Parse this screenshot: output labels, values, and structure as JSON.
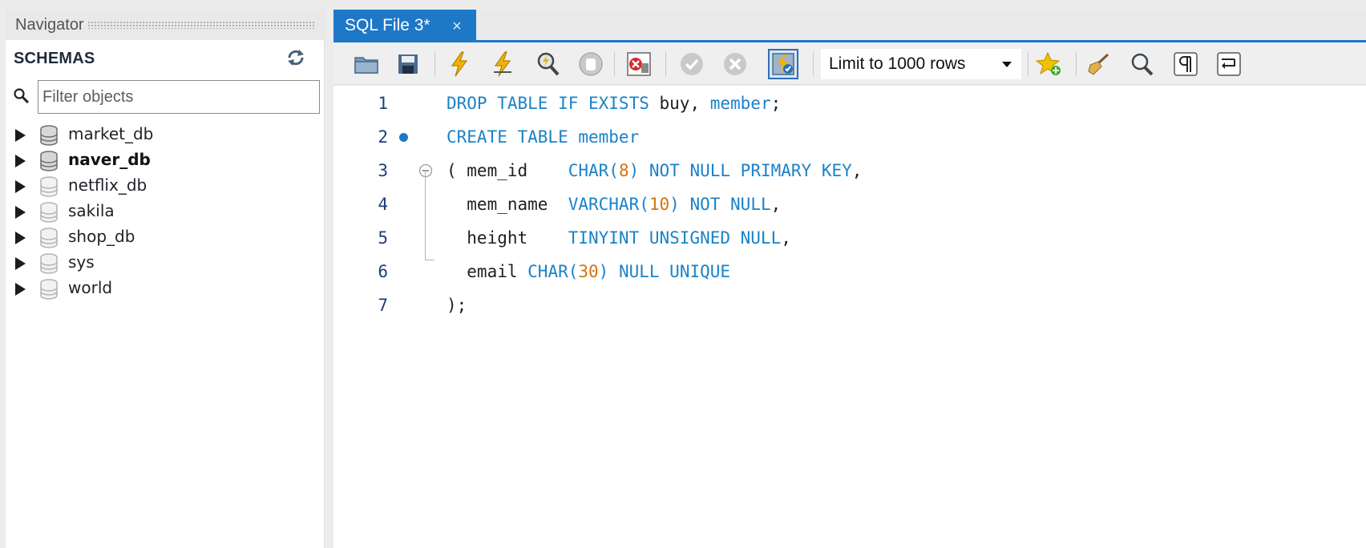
{
  "navigator": {
    "title": "Navigator",
    "schemas_title": "SCHEMAS",
    "filter": {
      "placeholder": "Filter objects",
      "value": ""
    },
    "schemas": [
      {
        "name": "market_db",
        "bold": false,
        "active": true
      },
      {
        "name": "naver_db",
        "bold": true,
        "active": true
      },
      {
        "name": "netflix_db",
        "bold": false,
        "active": false
      },
      {
        "name": "sakila",
        "bold": false,
        "active": false
      },
      {
        "name": "shop_db",
        "bold": false,
        "active": false
      },
      {
        "name": "sys",
        "bold": false,
        "active": false
      },
      {
        "name": "world",
        "bold": false,
        "active": false
      }
    ]
  },
  "tabs": [
    {
      "label": "SQL File 3*",
      "close": "×"
    }
  ],
  "toolbar": {
    "limit_label": "Limit to 1000 rows",
    "icons": [
      "open-folder-icon",
      "save-icon",
      "execute-icon",
      "execute-current-icon",
      "explain-icon",
      "stop-icon",
      "toggle-error-icon",
      "commit-icon",
      "rollback-icon",
      "autocommit-icon",
      "bookmark-icon",
      "beautify-icon",
      "find-icon",
      "invisible-chars-icon",
      "word-wrap-icon"
    ]
  },
  "editor": {
    "lines": [
      {
        "number": "1",
        "marker": false
      },
      {
        "number": "2",
        "marker": true
      },
      {
        "number": "3",
        "marker": false
      },
      {
        "number": "4",
        "marker": false
      },
      {
        "number": "5",
        "marker": false
      },
      {
        "number": "6",
        "marker": false
      },
      {
        "number": "7",
        "marker": false
      }
    ],
    "tokens": {
      "l1": [
        "DROP TABLE IF EXISTS",
        " buy, ",
        "member",
        ";"
      ],
      "l2": [
        "CREATE TABLE member"
      ],
      "l3": [
        "( mem_id    ",
        "CHAR(",
        "8",
        ")",
        " NOT NULL PRIMARY KEY",
        ","
      ],
      "l4": [
        "  mem_name  ",
        "VARCHAR(",
        "10",
        ")",
        " NOT NULL",
        ","
      ],
      "l5": [
        "  height    ",
        "TINYINT UNSIGNED NULL",
        ","
      ],
      "l6": [
        "  email ",
        "CHAR(",
        "30",
        ")",
        " NULL UNIQUE"
      ],
      "l7": [
        ");"
      ]
    }
  },
  "colors": {
    "accent": "#1e78c8",
    "keyword": "#1b82c8",
    "number": "#d2740f"
  }
}
